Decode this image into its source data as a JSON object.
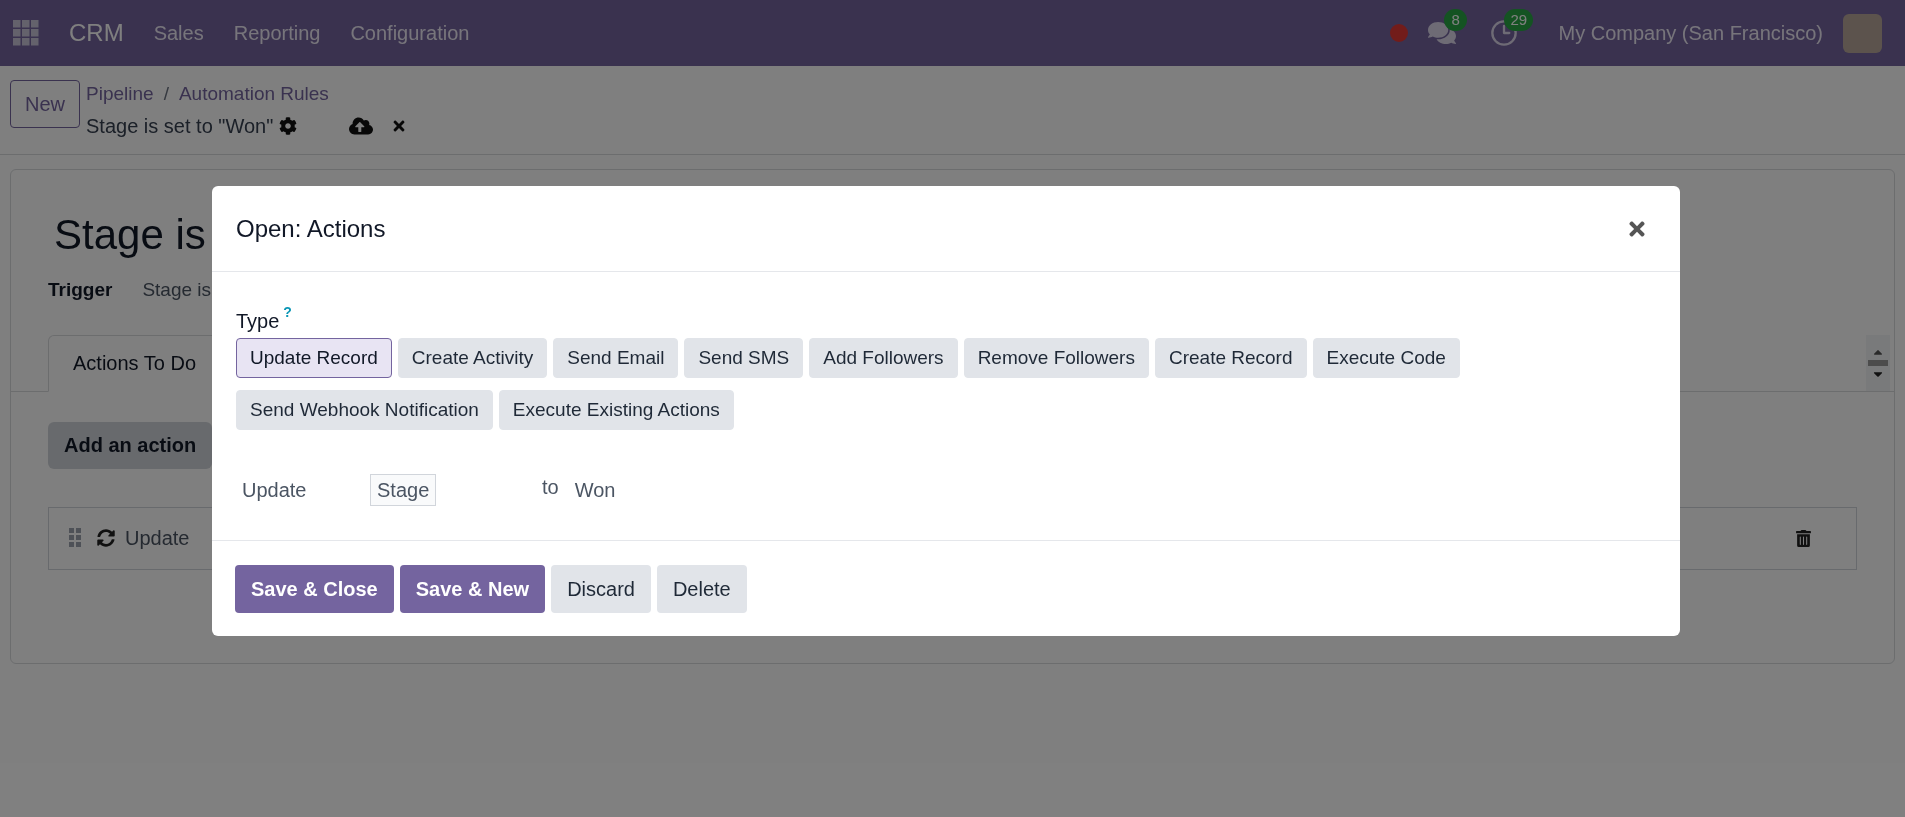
{
  "navbar": {
    "app": "CRM",
    "menu": [
      "Sales",
      "Reporting",
      "Configuration"
    ],
    "messages_count": "8",
    "activities_count": "29",
    "company": "My Company (San Francisco)"
  },
  "control_panel": {
    "new_button": "New",
    "breadcrumbs": [
      "Pipeline",
      "Automation Rules"
    ],
    "separator": "/",
    "record_title": "Stage is set to \"Won\""
  },
  "form": {
    "title": "Stage is",
    "trigger_label": "Trigger",
    "trigger_value": "Stage is",
    "tabs": [
      {
        "label": "Actions To Do",
        "selected": true
      }
    ],
    "add_action": "Add an action",
    "action_rows": [
      {
        "label": "Update"
      }
    ]
  },
  "dialog": {
    "title": "Open: Actions",
    "type_label": "Type",
    "help_mark": "?",
    "types": [
      {
        "label": "Update Record",
        "selected": true
      },
      {
        "label": "Create Activity",
        "selected": false
      },
      {
        "label": "Send Email",
        "selected": false
      },
      {
        "label": "Send SMS",
        "selected": false
      },
      {
        "label": "Add Followers",
        "selected": false
      },
      {
        "label": "Remove Followers",
        "selected": false
      },
      {
        "label": "Create Record",
        "selected": false
      },
      {
        "label": "Execute Code",
        "selected": false
      },
      {
        "label": "Send Webhook Notification",
        "selected": false
      },
      {
        "label": "Execute Existing Actions",
        "selected": false
      }
    ],
    "update_label": "Update",
    "field": "Stage",
    "to_label": "to",
    "value": "Won",
    "footer_buttons": [
      {
        "label": "Save & Close",
        "kind": "primary"
      },
      {
        "label": "Save & New",
        "kind": "primary"
      },
      {
        "label": "Discard",
        "kind": "secondary"
      },
      {
        "label": "Delete",
        "kind": "secondary"
      }
    ]
  }
}
